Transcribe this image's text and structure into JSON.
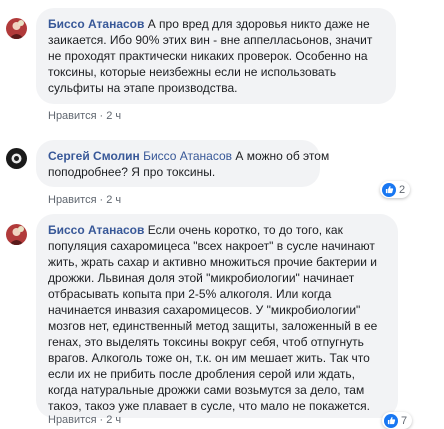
{
  "comments": [
    {
      "author": "Биссо Атанасов",
      "text_lines": [
        "А про вред для здоровья никто даже не",
        "заикается. Ибо 90% этих вин - вне аппелласьонов, значит",
        "не проходят практически никаких проверок. Особенно на",
        "токсины, которые неизбежны если не использовать",
        "сульфиты на этапе производства."
      ],
      "like_label": "Нравится",
      "time": "2 ч"
    },
    {
      "author": "Сергей Смолин",
      "mention": "Биссо Атанасов",
      "text_lines": [
        "А можно об этом",
        "поподробнее? Я про токсины."
      ],
      "like_label": "Нравится",
      "time": "2 ч",
      "reaction_count": "2"
    },
    {
      "author": "Биссо Атанасов",
      "text_lines": [
        "Если очень коротко, то до того, как",
        "популяция сахаромицеса \"всех накроет\" в сусле начинают",
        "жить, жрать сахар и активно множиться прочие бактерии и",
        "дрожжи. Львиная доля этой \"микробиологии\" начинает",
        "отбрасывать копыта при 2-5% алкоголя. Или когда",
        "начинается инвазия сахаромицесов. У \"микробиологии\"",
        "мозгов нет, единственный метод защиты, заложенный в ее",
        "генах, это выделять токсины вокруг себя, чтоб отпугнуть",
        "врагов. Алкоголь тоже он, т.к. он им мешает жить. Так что",
        "если их не прибить после дробления серой или ждать,",
        "когда натуральные дрожжи сами возьмутся за дело, там",
        "такоэ, такоэ уже плавает в сусле, что мало не покажется."
      ],
      "like_label": "Нравится",
      "time": "2 ч",
      "reaction_count": "7"
    }
  ],
  "colors": {
    "author": "#385898",
    "bubble": "#f2f3f5",
    "like_blue": "#1877f2",
    "meta": "#606770"
  }
}
